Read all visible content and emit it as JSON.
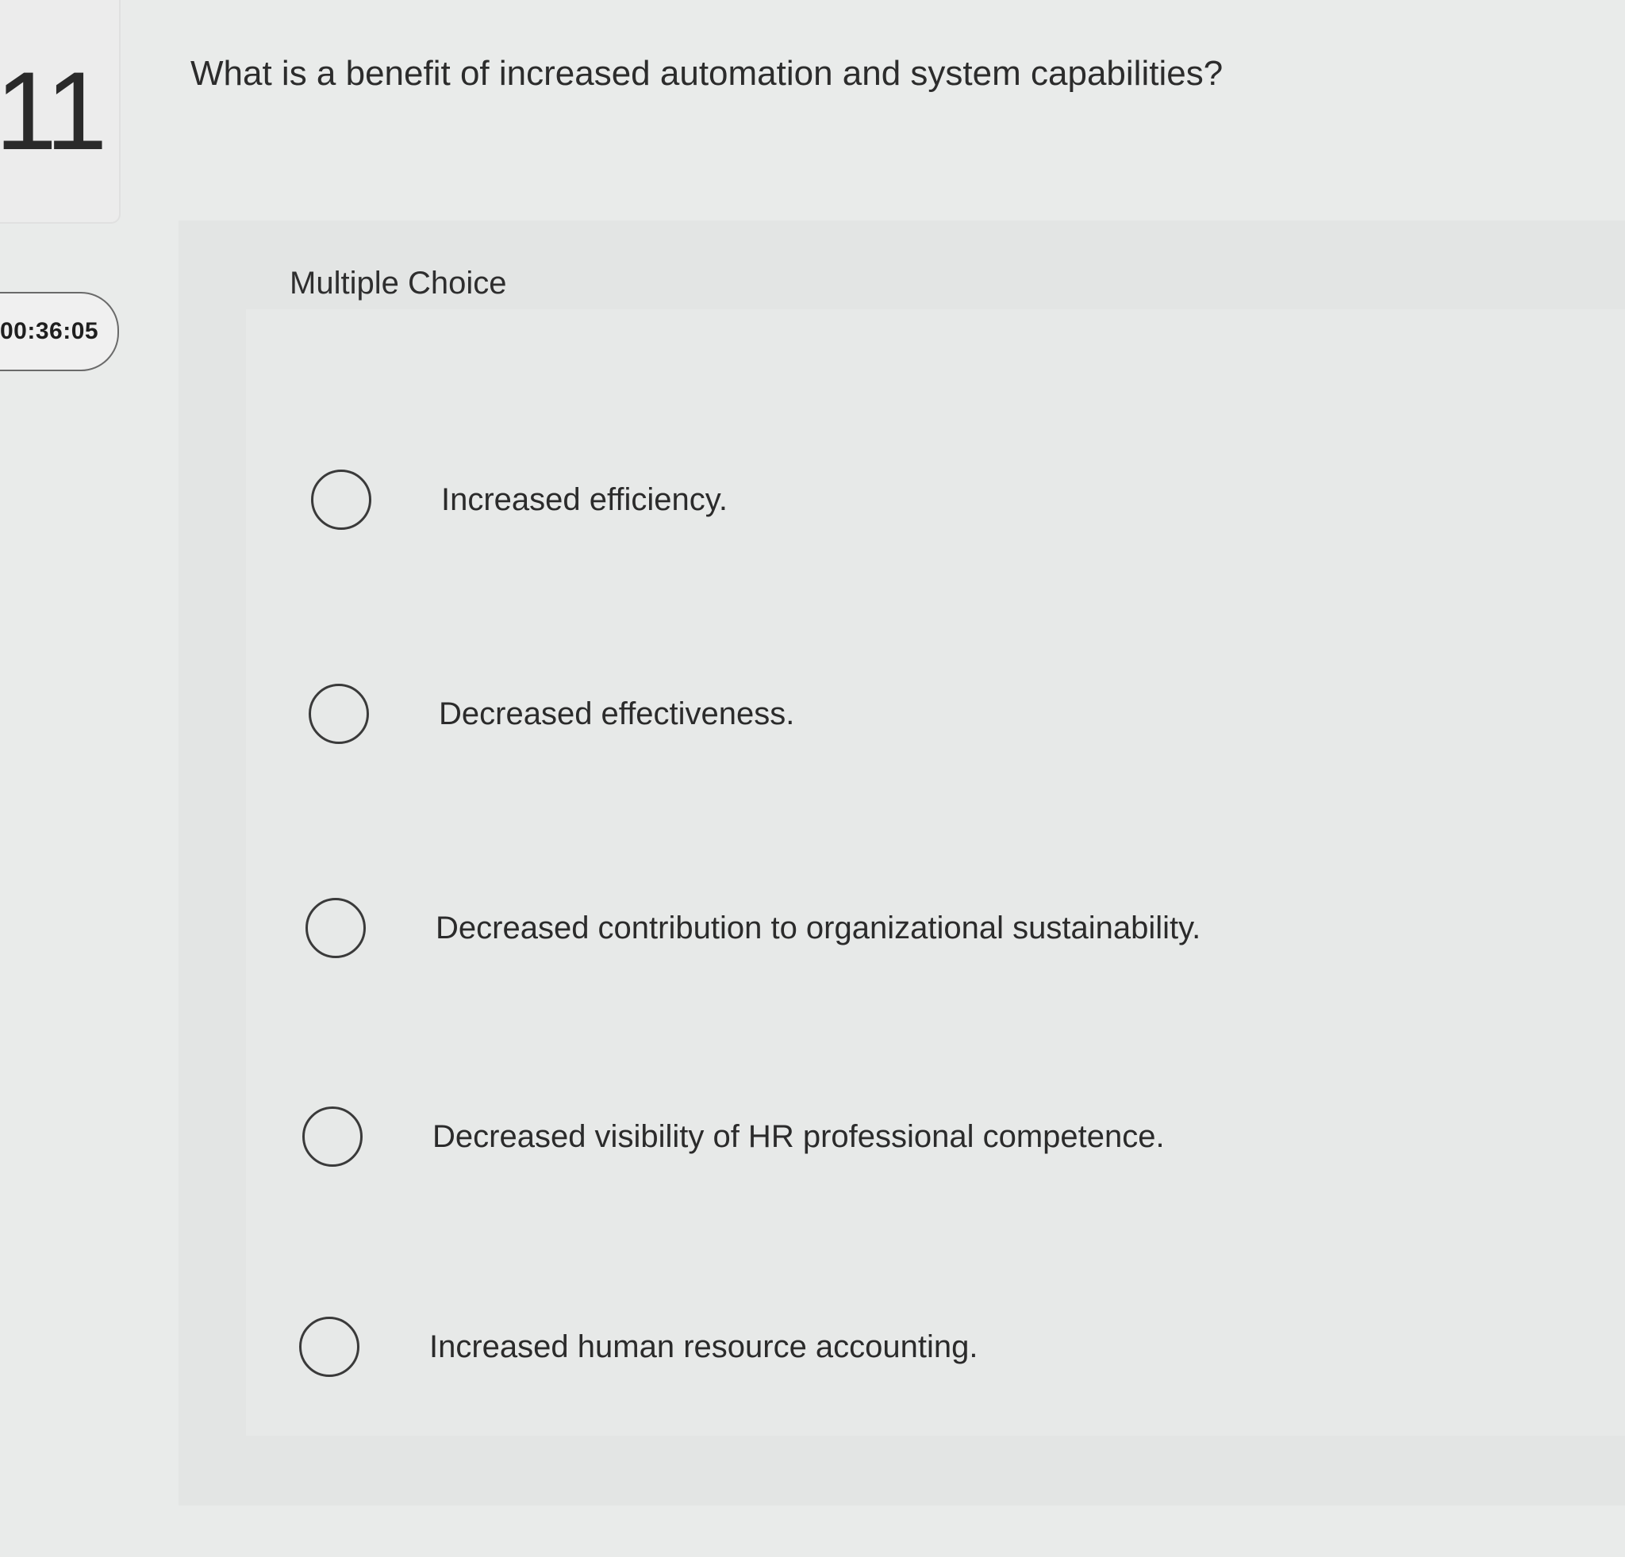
{
  "question": {
    "number": "11",
    "text": "What is a benefit of increased automation and system capabilities?"
  },
  "timer": {
    "value": "00:36:05"
  },
  "answer_panel": {
    "type_label": "Multiple Choice",
    "options": [
      {
        "label": "Increased efficiency.",
        "selected": false
      },
      {
        "label": "Decreased effectiveness.",
        "selected": false
      },
      {
        "label": "Decreased contribution to organizational sustainability.",
        "selected": false
      },
      {
        "label": "Decreased visibility of HR professional competence.",
        "selected": false
      },
      {
        "label": "Increased human resource accounting.",
        "selected": false
      }
    ]
  },
  "icons": {
    "radio": "radio-unselected-icon"
  }
}
